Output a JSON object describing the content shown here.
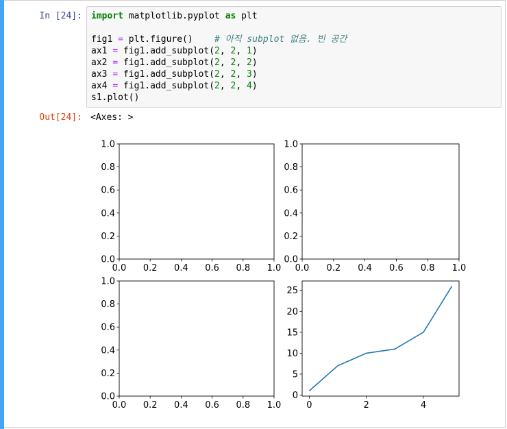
{
  "cell": {
    "in_prompt": "In [24]:",
    "out_prompt": "Out[24]:",
    "out_text": "<Axes: >",
    "accent_color": "#42a5f5"
  },
  "code": {
    "line1": {
      "kw1": "import",
      "mod": " matplotlib.pyplot ",
      "kw2": "as",
      "alias": " plt"
    },
    "line2": {
      "lhs": "fig1 ",
      "eq": "=",
      "rhs": " plt.figure()    ",
      "comment": "# 아직 subplot 없음. 빈 공간"
    },
    "line3": {
      "lhs": "ax1 ",
      "eq": "=",
      "rhs": " fig1.add_subplot(",
      "a": "2",
      "s1": ", ",
      "b": "2",
      "s2": ", ",
      "c": "1",
      "end": ")"
    },
    "line4": {
      "lhs": "ax2 ",
      "eq": "=",
      "rhs": " fig1.add_subplot(",
      "a": "2",
      "s1": ", ",
      "b": "2",
      "s2": ", ",
      "c": "2",
      "end": ")"
    },
    "line5": {
      "lhs": "ax3 ",
      "eq": "=",
      "rhs": " fig1.add_subplot(",
      "a": "2",
      "s1": ", ",
      "b": "2",
      "s2": ", ",
      "c": "3",
      "end": ")"
    },
    "line6": {
      "lhs": "ax4 ",
      "eq": "=",
      "rhs": " fig1.add_subplot(",
      "a": "2",
      "s1": ", ",
      "b": "2",
      "s2": ", ",
      "c": "4",
      "end": ")"
    },
    "line7": {
      "text": "s1.plot()"
    }
  },
  "chart_data": [
    {
      "type": "line",
      "position": "top-left",
      "series": [],
      "xlim": [
        0,
        1
      ],
      "ylim": [
        0,
        1
      ],
      "xticks": [
        "0.0",
        "0.2",
        "0.4",
        "0.6",
        "0.8",
        "1.0"
      ],
      "yticks": [
        "0.0",
        "0.2",
        "0.4",
        "0.6",
        "0.8",
        "1.0"
      ]
    },
    {
      "type": "line",
      "position": "top-right",
      "series": [],
      "xlim": [
        0,
        1
      ],
      "ylim": [
        0,
        1
      ],
      "xticks": [
        "0.0",
        "0.2",
        "0.4",
        "0.6",
        "0.8",
        "1.0"
      ],
      "yticks": [
        "0.0",
        "0.2",
        "0.4",
        "0.6",
        "0.8",
        "1.0"
      ]
    },
    {
      "type": "line",
      "position": "bottom-left",
      "series": [],
      "xlim": [
        0,
        1
      ],
      "ylim": [
        0,
        1
      ],
      "xticks": [
        "0.0",
        "0.2",
        "0.4",
        "0.6",
        "0.8",
        "1.0"
      ],
      "yticks": [
        "0.0",
        "0.2",
        "0.4",
        "0.6",
        "0.8",
        "1.0"
      ]
    },
    {
      "type": "line",
      "position": "bottom-right",
      "series": [
        {
          "x": [
            0,
            1,
            2,
            3,
            4,
            5
          ],
          "y": [
            1,
            7,
            10,
            11,
            15,
            26
          ],
          "color": "#1f77b4"
        }
      ],
      "xlim": [
        -0.25,
        5.25
      ],
      "ylim": [
        -0.25,
        27.25
      ],
      "xticks": [
        "0",
        "2",
        "4"
      ],
      "yticks": [
        "0",
        "5",
        "10",
        "15",
        "20",
        "25"
      ]
    }
  ]
}
